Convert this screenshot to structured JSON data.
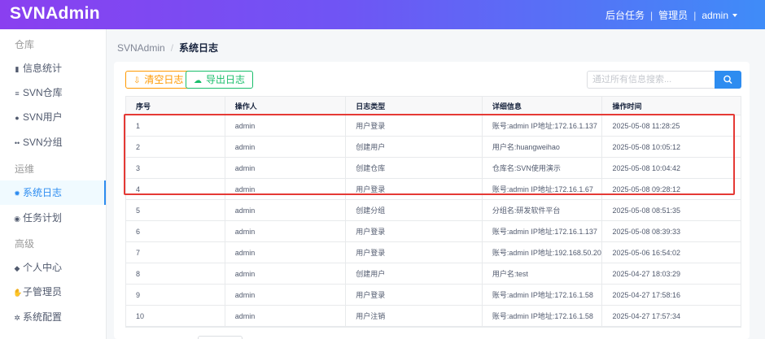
{
  "app": {
    "title": "SVNAdmin"
  },
  "topbar": {
    "tasks_link": "后台任务",
    "separator": "|",
    "admin_link": "管理员",
    "user": "admin"
  },
  "sidebar": {
    "groups": [
      {
        "title": "仓库",
        "items": [
          {
            "label": "信息统计",
            "icon": "bar-chart-icon"
          },
          {
            "label": "SVN仓库",
            "icon": "database-icon"
          },
          {
            "label": "SVN用户",
            "icon": "user-icon"
          },
          {
            "label": "SVN分组",
            "icon": "users-icon"
          }
        ]
      },
      {
        "title": "运维",
        "items": [
          {
            "label": "系统日志",
            "icon": "bug-icon",
            "active": true
          },
          {
            "label": "任务计划",
            "icon": "alarm-icon"
          }
        ]
      },
      {
        "title": "高级",
        "items": [
          {
            "label": "个人中心",
            "icon": "cube-icon"
          },
          {
            "label": "子管理员",
            "icon": "hand-icon"
          },
          {
            "label": "系统配置",
            "icon": "gear-icon"
          }
        ]
      }
    ]
  },
  "breadcrumb": {
    "root": "SVNAdmin",
    "separator": "/",
    "current": "系统日志"
  },
  "toolbar": {
    "clear_label": "清空日志",
    "export_label": "导出日志",
    "search_placeholder": "通过所有信息搜索..."
  },
  "table": {
    "columns": [
      "序号",
      "操作人",
      "日志类型",
      "详细信息",
      "操作时间"
    ],
    "rows": [
      [
        "1",
        "admin",
        "用户登录",
        "账号:admin IP地址:172.16.1.137",
        "2025-05-08 11:28:25"
      ],
      [
        "2",
        "admin",
        "创建用户",
        "用户名:huangweihao",
        "2025-05-08 10:05:12"
      ],
      [
        "3",
        "admin",
        "创建仓库",
        "仓库名:SVN使用演示",
        "2025-05-08 10:04:42"
      ],
      [
        "4",
        "admin",
        "用户登录",
        "账号:admin IP地址:172.16.1.67",
        "2025-05-08 09:28:12"
      ],
      [
        "5",
        "admin",
        "创建分组",
        "分组名:研发软件平台",
        "2025-05-08 08:51:35"
      ],
      [
        "6",
        "admin",
        "用户登录",
        "账号:admin IP地址:172.16.1.137",
        "2025-05-08 08:39:33"
      ],
      [
        "7",
        "admin",
        "用户登录",
        "账号:admin IP地址:192.168.50.20",
        "2025-05-06 16:54:02"
      ],
      [
        "8",
        "admin",
        "创建用户",
        "用户名:test",
        "2025-04-27 18:03:29"
      ],
      [
        "9",
        "admin",
        "用户登录",
        "账号:admin IP地址:172.16.1.58",
        "2025-04-27 17:58:16"
      ],
      [
        "10",
        "admin",
        "用户注销",
        "账号:admin IP地址:172.16.1.58",
        "2025-04-27 17:57:34"
      ]
    ]
  },
  "colors": {
    "primary": "#2d8cf0",
    "warning": "#ff9900",
    "success": "#19be6b",
    "highlight": "#e53935"
  }
}
